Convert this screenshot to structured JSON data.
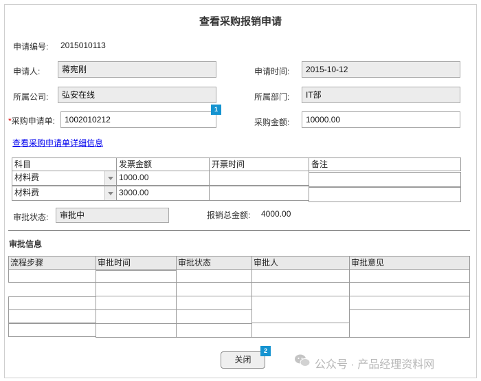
{
  "page_title": "查看采购报销申请",
  "form": {
    "apply_no_label": "申请编号:",
    "apply_no_value": "2015010113",
    "applicant_label": "申请人:",
    "applicant_value": "蒋宪刚",
    "apply_time_label": "申请时间:",
    "apply_time_value": "2015-10-12",
    "company_label": "所属公司:",
    "company_value": "弘安在线",
    "dept_label": "所属部门:",
    "dept_value": "IT部",
    "required_mark": "*",
    "po_label": "采购申请单:",
    "po_value": "1002010212",
    "amount_label": "采购金额:",
    "amount_value": "10000.00",
    "detail_link": "查看采购申请单详细信息"
  },
  "markers": {
    "m1": "1",
    "m2": "2"
  },
  "items_table": {
    "headers": [
      "科目",
      "发票金额",
      "开票时间",
      "备注"
    ],
    "rows": [
      {
        "subject": "材料费",
        "amount": "1000.00",
        "time": "",
        "note": ""
      },
      {
        "subject": "材料费",
        "amount": "3000.00",
        "time": "",
        "note": ""
      }
    ]
  },
  "status": {
    "label": "审批状态:",
    "value": "审批中",
    "total_label": "报销总金额:",
    "total_value": "4000.00"
  },
  "approval": {
    "section_title": "审批信息",
    "headers": [
      "流程步骤",
      "审批时间",
      "审批状态",
      "审批人",
      "审批意见"
    ]
  },
  "close_button": "关闭",
  "watermark": "公众号 · 产品经理资料网",
  "colors": {
    "marker": "#1593d0",
    "link": "#0000ee",
    "required": "#dd0000",
    "readonly_bg": "#ececec"
  }
}
